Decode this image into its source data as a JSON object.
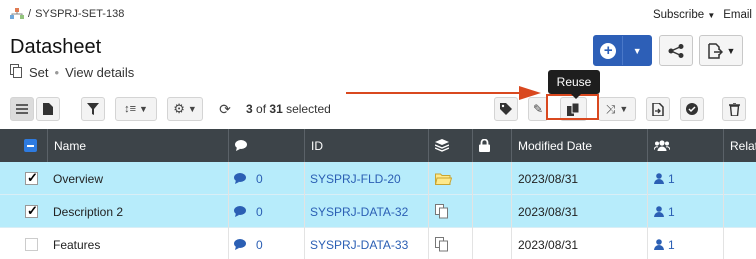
{
  "breadcrumb": {
    "path": "SYSPRJ-SET-138"
  },
  "topright": {
    "subscribe": "Subscribe",
    "email": "Email"
  },
  "page": {
    "title": "Datasheet",
    "type": "Set",
    "view_details": "View details"
  },
  "toolbar": {
    "count": "3",
    "of": "of",
    "total": "31",
    "selected": "selected"
  },
  "tooltip": {
    "label": "Reuse"
  },
  "table": {
    "headers": [
      "Name",
      "ID",
      "Modified Date",
      "Relat"
    ],
    "rows": [
      {
        "name": "Overview",
        "comments": "0",
        "id": "SYSPRJ-FLD-20",
        "modified": "2023/08/31",
        "users": "1",
        "selected": true
      },
      {
        "name": "Description 2",
        "comments": "0",
        "id": "SYSPRJ-DATA-32",
        "modified": "2023/08/31",
        "users": "1",
        "selected": true
      },
      {
        "name": "Features",
        "comments": "0",
        "id": "SYSPRJ-DATA-33",
        "modified": "2023/08/31",
        "users": "1",
        "selected": false
      }
    ]
  },
  "colors": {
    "header_bg": "#3d4449",
    "selected_row": "#b7ecfb",
    "accent": "#2d5fb7",
    "annotation": "#d9481f"
  }
}
